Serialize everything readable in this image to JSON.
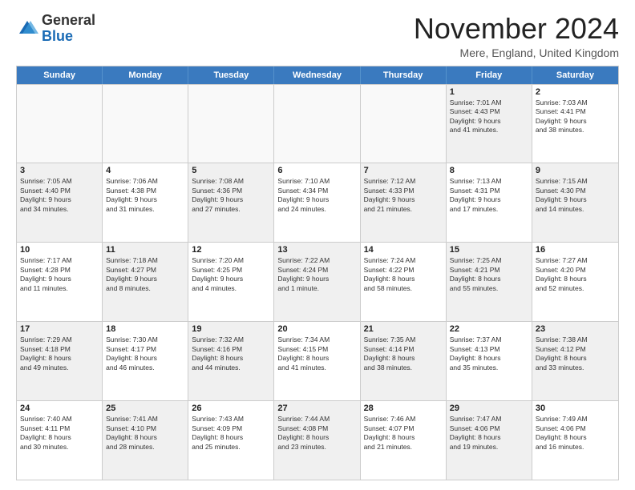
{
  "logo": {
    "general": "General",
    "blue": "Blue"
  },
  "title": "November 2024",
  "location": "Mere, England, United Kingdom",
  "days_of_week": [
    "Sunday",
    "Monday",
    "Tuesday",
    "Wednesday",
    "Thursday",
    "Friday",
    "Saturday"
  ],
  "rows": [
    [
      {
        "day": "",
        "info": "",
        "empty": true
      },
      {
        "day": "",
        "info": "",
        "empty": true
      },
      {
        "day": "",
        "info": "",
        "empty": true
      },
      {
        "day": "",
        "info": "",
        "empty": true
      },
      {
        "day": "",
        "info": "",
        "empty": true
      },
      {
        "day": "1",
        "info": "Sunrise: 7:01 AM\nSunset: 4:43 PM\nDaylight: 9 hours\nand 41 minutes.",
        "shaded": true
      },
      {
        "day": "2",
        "info": "Sunrise: 7:03 AM\nSunset: 4:41 PM\nDaylight: 9 hours\nand 38 minutes.",
        "shaded": false
      }
    ],
    [
      {
        "day": "3",
        "info": "Sunrise: 7:05 AM\nSunset: 4:40 PM\nDaylight: 9 hours\nand 34 minutes.",
        "shaded": true
      },
      {
        "day": "4",
        "info": "Sunrise: 7:06 AM\nSunset: 4:38 PM\nDaylight: 9 hours\nand 31 minutes.",
        "shaded": false
      },
      {
        "day": "5",
        "info": "Sunrise: 7:08 AM\nSunset: 4:36 PM\nDaylight: 9 hours\nand 27 minutes.",
        "shaded": true
      },
      {
        "day": "6",
        "info": "Sunrise: 7:10 AM\nSunset: 4:34 PM\nDaylight: 9 hours\nand 24 minutes.",
        "shaded": false
      },
      {
        "day": "7",
        "info": "Sunrise: 7:12 AM\nSunset: 4:33 PM\nDaylight: 9 hours\nand 21 minutes.",
        "shaded": true
      },
      {
        "day": "8",
        "info": "Sunrise: 7:13 AM\nSunset: 4:31 PM\nDaylight: 9 hours\nand 17 minutes.",
        "shaded": false
      },
      {
        "day": "9",
        "info": "Sunrise: 7:15 AM\nSunset: 4:30 PM\nDaylight: 9 hours\nand 14 minutes.",
        "shaded": true
      }
    ],
    [
      {
        "day": "10",
        "info": "Sunrise: 7:17 AM\nSunset: 4:28 PM\nDaylight: 9 hours\nand 11 minutes.",
        "shaded": false
      },
      {
        "day": "11",
        "info": "Sunrise: 7:18 AM\nSunset: 4:27 PM\nDaylight: 9 hours\nand 8 minutes.",
        "shaded": true
      },
      {
        "day": "12",
        "info": "Sunrise: 7:20 AM\nSunset: 4:25 PM\nDaylight: 9 hours\nand 4 minutes.",
        "shaded": false
      },
      {
        "day": "13",
        "info": "Sunrise: 7:22 AM\nSunset: 4:24 PM\nDaylight: 9 hours\nand 1 minute.",
        "shaded": true
      },
      {
        "day": "14",
        "info": "Sunrise: 7:24 AM\nSunset: 4:22 PM\nDaylight: 8 hours\nand 58 minutes.",
        "shaded": false
      },
      {
        "day": "15",
        "info": "Sunrise: 7:25 AM\nSunset: 4:21 PM\nDaylight: 8 hours\nand 55 minutes.",
        "shaded": true
      },
      {
        "day": "16",
        "info": "Sunrise: 7:27 AM\nSunset: 4:20 PM\nDaylight: 8 hours\nand 52 minutes.",
        "shaded": false
      }
    ],
    [
      {
        "day": "17",
        "info": "Sunrise: 7:29 AM\nSunset: 4:18 PM\nDaylight: 8 hours\nand 49 minutes.",
        "shaded": true
      },
      {
        "day": "18",
        "info": "Sunrise: 7:30 AM\nSunset: 4:17 PM\nDaylight: 8 hours\nand 46 minutes.",
        "shaded": false
      },
      {
        "day": "19",
        "info": "Sunrise: 7:32 AM\nSunset: 4:16 PM\nDaylight: 8 hours\nand 44 minutes.",
        "shaded": true
      },
      {
        "day": "20",
        "info": "Sunrise: 7:34 AM\nSunset: 4:15 PM\nDaylight: 8 hours\nand 41 minutes.",
        "shaded": false
      },
      {
        "day": "21",
        "info": "Sunrise: 7:35 AM\nSunset: 4:14 PM\nDaylight: 8 hours\nand 38 minutes.",
        "shaded": true
      },
      {
        "day": "22",
        "info": "Sunrise: 7:37 AM\nSunset: 4:13 PM\nDaylight: 8 hours\nand 35 minutes.",
        "shaded": false
      },
      {
        "day": "23",
        "info": "Sunrise: 7:38 AM\nSunset: 4:12 PM\nDaylight: 8 hours\nand 33 minutes.",
        "shaded": true
      }
    ],
    [
      {
        "day": "24",
        "info": "Sunrise: 7:40 AM\nSunset: 4:11 PM\nDaylight: 8 hours\nand 30 minutes.",
        "shaded": false
      },
      {
        "day": "25",
        "info": "Sunrise: 7:41 AM\nSunset: 4:10 PM\nDaylight: 8 hours\nand 28 minutes.",
        "shaded": true
      },
      {
        "day": "26",
        "info": "Sunrise: 7:43 AM\nSunset: 4:09 PM\nDaylight: 8 hours\nand 25 minutes.",
        "shaded": false
      },
      {
        "day": "27",
        "info": "Sunrise: 7:44 AM\nSunset: 4:08 PM\nDaylight: 8 hours\nand 23 minutes.",
        "shaded": true
      },
      {
        "day": "28",
        "info": "Sunrise: 7:46 AM\nSunset: 4:07 PM\nDaylight: 8 hours\nand 21 minutes.",
        "shaded": false
      },
      {
        "day": "29",
        "info": "Sunrise: 7:47 AM\nSunset: 4:06 PM\nDaylight: 8 hours\nand 19 minutes.",
        "shaded": true
      },
      {
        "day": "30",
        "info": "Sunrise: 7:49 AM\nSunset: 4:06 PM\nDaylight: 8 hours\nand 16 minutes.",
        "shaded": false
      }
    ]
  ]
}
